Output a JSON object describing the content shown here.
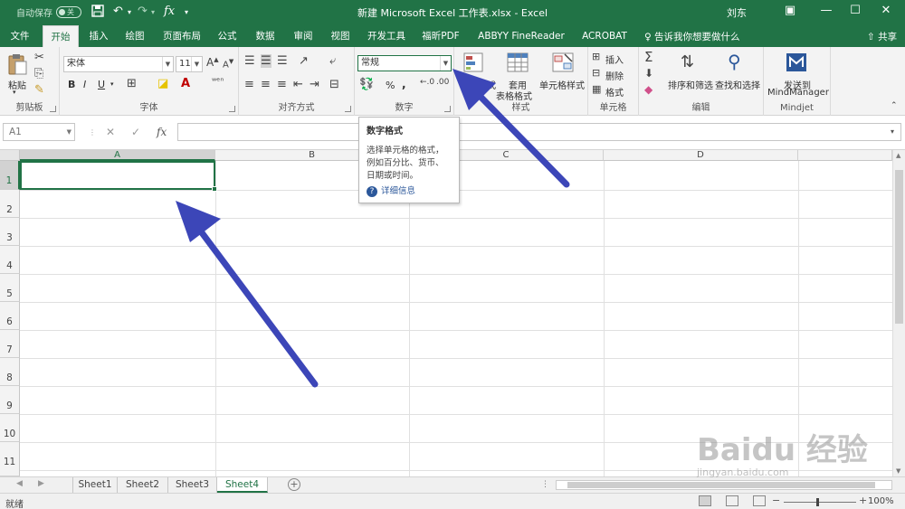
{
  "titlebar": {
    "autosave_label": "自动保存",
    "toggle_state": "关",
    "doc_title": "新建 Microsoft Excel 工作表.xlsx  -  Excel",
    "user": "刘东"
  },
  "tabs": [
    "文件",
    "开始",
    "插入",
    "绘图",
    "页面布局",
    "公式",
    "数据",
    "审阅",
    "视图",
    "开发工具",
    "福昕PDF",
    "ABBYY FineReader 12",
    "ACROBAT"
  ],
  "active_tab": "开始",
  "tell_me": "告诉我你想要做什么",
  "share": "共享",
  "ribbon": {
    "clipboard": {
      "label": "剪贴板",
      "paste": "粘贴"
    },
    "font": {
      "label": "字体",
      "font_name": "宋体",
      "font_size": "11",
      "bold": "B",
      "italic": "I",
      "underline": "U"
    },
    "alignment": {
      "label": "对齐方式"
    },
    "number": {
      "label": "数字",
      "format": "常规",
      "percent": "%",
      "comma": ","
    },
    "styles": {
      "label": "样式",
      "cond_format": "条件格式",
      "table_format_1": "套用",
      "table_format_2": "表格格式",
      "cell_styles": "单元格样式"
    },
    "cells": {
      "label": "单元格",
      "insert": "插入",
      "delete": "删除",
      "format": "格式"
    },
    "editing": {
      "label": "编辑",
      "sort_filter": "排序和筛选",
      "find_select": "查找和选择"
    },
    "mindjet": {
      "label": "Mindjet",
      "send_1": "发送到",
      "send_2": "MindManager"
    }
  },
  "formula_bar": {
    "name_box": "A1",
    "cancel": "✕",
    "enter": "✓",
    "fx": "fx",
    "content": ""
  },
  "grid": {
    "columns": [
      "A",
      "B",
      "C",
      "D"
    ],
    "rows": [
      "1",
      "2",
      "3",
      "4",
      "5",
      "6",
      "7",
      "8",
      "9",
      "10",
      "11"
    ],
    "selected_cell": "A1"
  },
  "tooltip": {
    "title": "数字格式",
    "description": "选择单元格的格式，例如百分比、货币、日期或时间。",
    "more_info": "详细信息"
  },
  "sheets": [
    "Sheet1",
    "Sheet2",
    "Sheet3",
    "Sheet4"
  ],
  "active_sheet": "Sheet4",
  "status": {
    "ready": "就绪",
    "zoom": "100%"
  },
  "watermark": {
    "text": "Baidu 经验",
    "url": "jingyan.baidu.com"
  },
  "colors": {
    "excel_green": "#217346",
    "arrow_blue": "#3c46b8"
  }
}
